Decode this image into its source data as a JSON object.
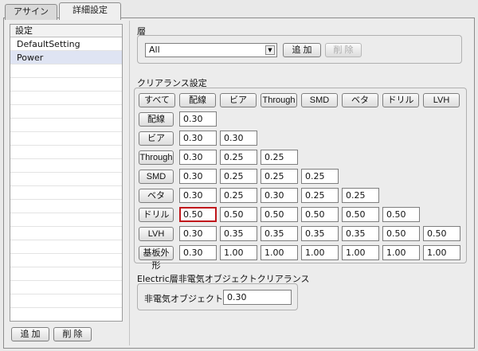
{
  "tabs": [
    {
      "label": "アサイン",
      "active": false
    },
    {
      "label": "詳細設定",
      "active": true
    }
  ],
  "list": {
    "header": "設定",
    "items": [
      "DefaultSetting",
      "Power"
    ],
    "selected_index": 1,
    "add_label": "追 加",
    "delete_label": "削 除"
  },
  "layer": {
    "section_label": "層",
    "selected": "All",
    "add_label": "追 加",
    "delete_label": "削 除"
  },
  "clearance": {
    "section_label": "クリアランス設定",
    "column_buttons": [
      "すべて",
      "配線",
      "ビア",
      "Through",
      "SMD",
      "ベタ",
      "ドリル",
      "LVH"
    ],
    "row_labels": [
      "配線",
      "ビア",
      "Through",
      "SMD",
      "ベタ",
      "ドリル",
      "LVH",
      "基板外形"
    ],
    "rows": [
      [
        "0.30"
      ],
      [
        "0.30",
        "0.30"
      ],
      [
        "0.30",
        "0.25",
        "0.25"
      ],
      [
        "0.30",
        "0.25",
        "0.25",
        "0.25"
      ],
      [
        "0.30",
        "0.25",
        "0.30",
        "0.25",
        "0.25"
      ],
      [
        "0.50",
        "0.50",
        "0.50",
        "0.50",
        "0.50",
        "0.50"
      ],
      [
        "0.30",
        "0.35",
        "0.35",
        "0.35",
        "0.35",
        "0.50",
        "0.50"
      ],
      [
        "0.30",
        "1.00",
        "1.00",
        "1.00",
        "1.00",
        "1.00",
        "1.00"
      ]
    ],
    "focused": {
      "row": 5,
      "col": 0
    },
    "focus_color": "#c0161b"
  },
  "electric": {
    "section_label": "Electric層非電気オブジェクトクリアランス",
    "field_label": "非電気オブジェクト",
    "value": "0.30"
  }
}
